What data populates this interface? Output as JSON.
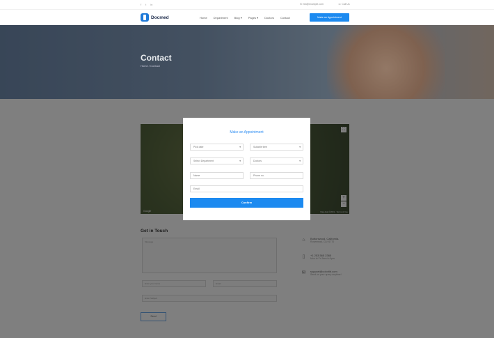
{
  "topbar": {
    "social": [
      "f",
      "t",
      "in"
    ],
    "email": "info@example.com",
    "phone": "Call Us"
  },
  "header": {
    "logo": "Docmed",
    "nav": [
      "Home",
      "Department",
      "Blog",
      "Pages",
      "Doctors",
      "Contact"
    ],
    "cta": "Make an Appointment"
  },
  "hero": {
    "title": "Contact",
    "breadcrumb": "Home / Contact"
  },
  "map": {
    "brand": "Google",
    "credits": "Map data ©2019 · Terms of Use",
    "zoom_in": "+",
    "zoom_out": "−",
    "fullscreen": "⛶"
  },
  "modal": {
    "title": "Make an Appointment",
    "date_placeholder": "Pick date",
    "time_placeholder": "Suitable time",
    "department_placeholder": "Select Department",
    "doctor_placeholder": "Doctors",
    "name_placeholder": "Name",
    "phone_placeholder": "Phone no.",
    "email_placeholder": "Email",
    "confirm": "Confirm"
  },
  "contact_form": {
    "title": "Get in Touch",
    "message_placeholder": "Message",
    "name_placeholder": "Enter your name",
    "email_placeholder": "Email",
    "subject_placeholder": "Enter Subject",
    "send": "Send"
  },
  "contact_info": [
    {
      "icon": "home-icon",
      "line1": "Buttonwood, California.",
      "line2": "Rosemead, CA 91770"
    },
    {
      "icon": "phone-icon",
      "line1": "+1 253 565 2365",
      "line2": "Mon to Fri 9am to 6pm"
    },
    {
      "icon": "mail-icon",
      "line1": "support@colorlib.com",
      "line2": "Send us your query anytime!"
    }
  ],
  "colors": {
    "accent": "#1c8af0",
    "overlay": "rgba(0,0,0,0.5)"
  }
}
